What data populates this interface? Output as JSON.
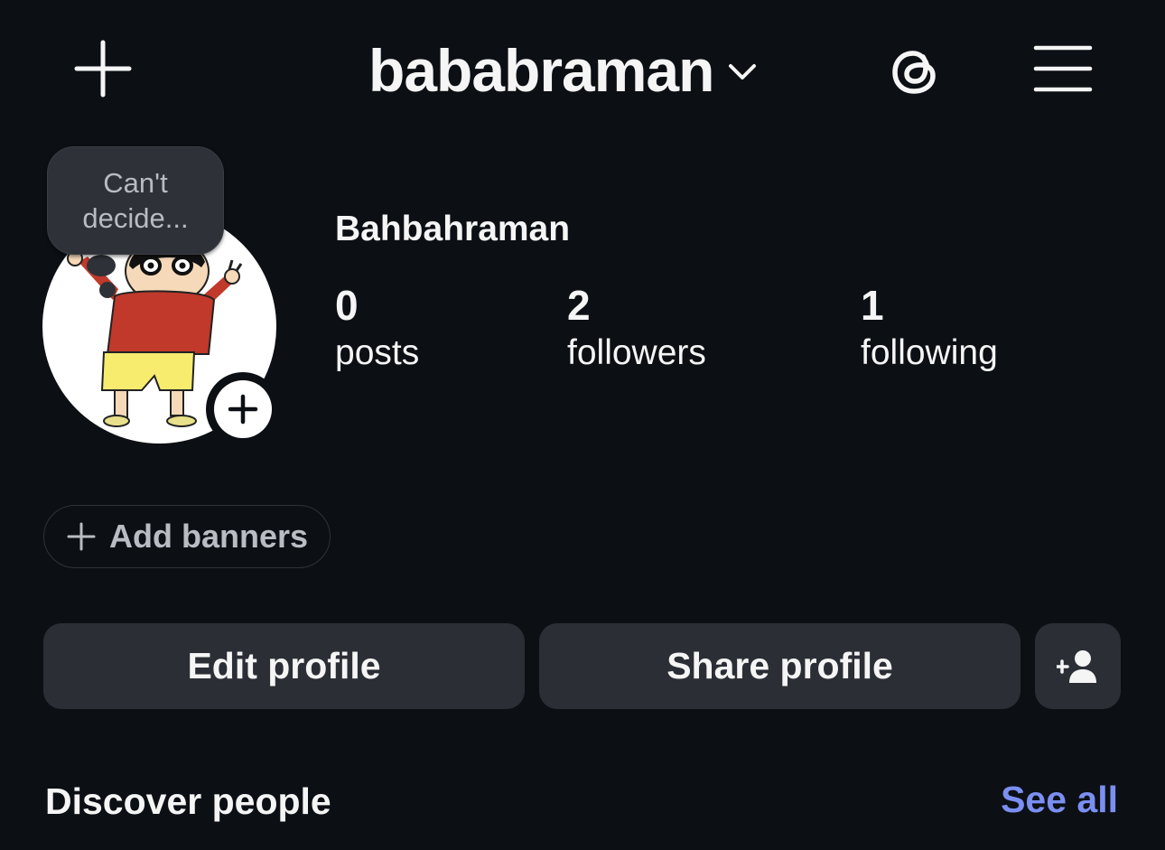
{
  "header": {
    "username": "bababraman",
    "icons": {
      "add": "plus-icon",
      "switch_account": "chevron-down-icon",
      "threads": "threads-icon",
      "menu": "hamburger-menu-icon"
    }
  },
  "profile": {
    "note": "Can't decide...",
    "full_name": "Bahbahraman",
    "avatar_icon": "avatar-cartoon-image",
    "avatar_add_icon": "plus-icon"
  },
  "stats": [
    {
      "value": "0",
      "label": "posts"
    },
    {
      "value": "2",
      "label": "followers"
    },
    {
      "value": "1",
      "label": "following"
    }
  ],
  "banners": {
    "label": "Add banners",
    "icon": "plus-icon"
  },
  "actions": {
    "edit_label": "Edit profile",
    "share_label": "Share profile",
    "discover_icon": "add-person-icon"
  },
  "discover": {
    "title": "Discover people",
    "see_all": "See all"
  },
  "colors": {
    "background": "#0c0f14",
    "button": "#2b2e35",
    "link": "#7b8ff2",
    "text": "#f5f5f5"
  }
}
